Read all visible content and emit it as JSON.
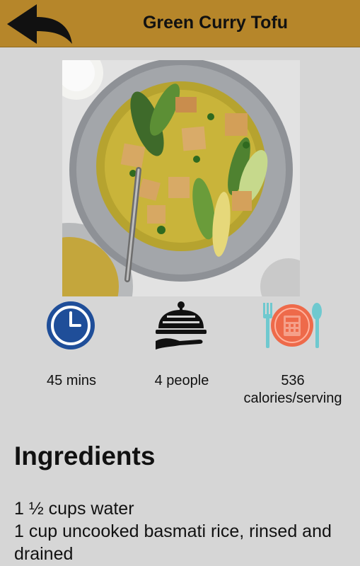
{
  "header": {
    "title": "Green Curry Tofu",
    "background": "#b6862a",
    "back_icon": "back-arrow-icon"
  },
  "hero_image": {
    "subject": "green curry tofu bowl photo"
  },
  "info": [
    {
      "icon": "clock-icon",
      "text": "45 mins"
    },
    {
      "icon": "serving-cloche-icon",
      "text": "4 people"
    },
    {
      "icon": "calculator-cutlery-icon",
      "text_line1": "536",
      "text_line2": "calories/serving"
    }
  ],
  "ingredients": {
    "heading": "Ingredients",
    "items": [
      "1 ½ cups water",
      "1 cup uncooked basmati rice, rinsed and drained"
    ]
  },
  "colors": {
    "page_background": "#d6d6d6",
    "clock_blue": "#1f4e99",
    "calc_orange": "#ee6a4a",
    "cutlery_teal": "#6fc9cf"
  }
}
